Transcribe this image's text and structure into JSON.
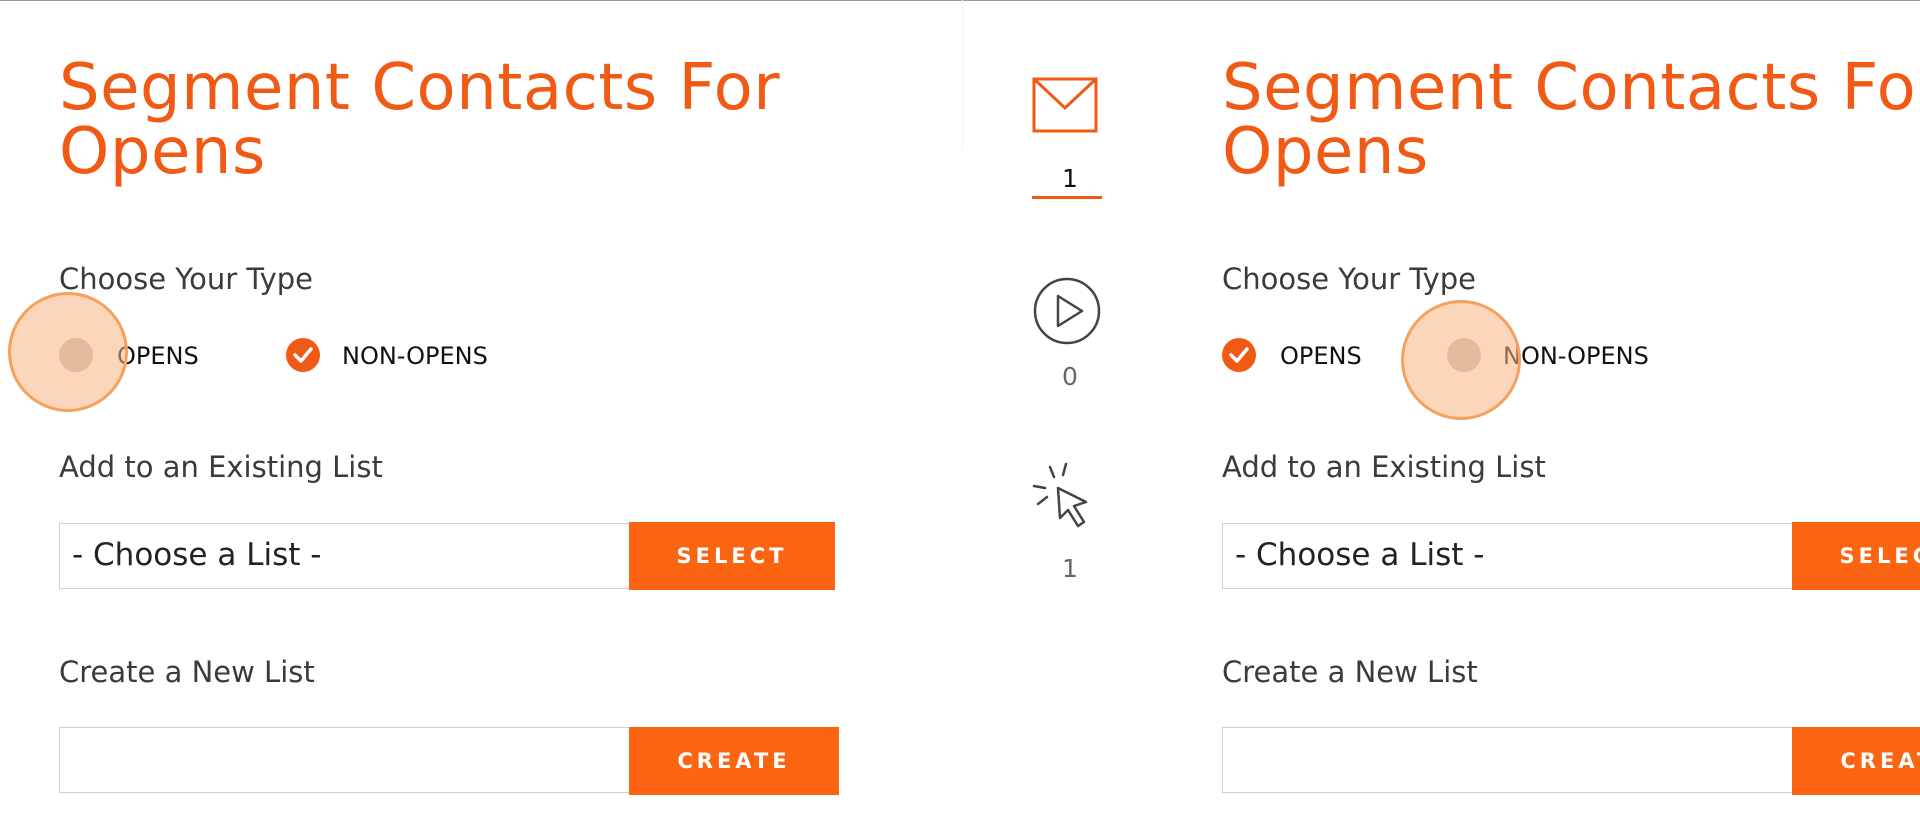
{
  "colors": {
    "accent": "#f05a14",
    "button": "#fb6410",
    "text": "#3b3b3b"
  },
  "panels": [
    {
      "title_line1": "Segment Contacts For",
      "title_line2": "Opens",
      "type_label": "Choose Your Type",
      "options": [
        {
          "label": "OPENS",
          "checked": false
        },
        {
          "label": "NON-OPENS",
          "checked": true
        }
      ],
      "existing_list_label": "Add to an Existing List",
      "list_select_value": "- Choose a List -",
      "select_button": "SELECT",
      "new_list_label": "Create a New List",
      "new_list_value": "",
      "create_button": "CREATE"
    },
    {
      "title_line1": "Segment Contacts For",
      "title_line2": "Opens",
      "type_label": "Choose Your Type",
      "options": [
        {
          "label": "OPENS",
          "checked": true
        },
        {
          "label": "NON-OPENS",
          "checked": false
        }
      ],
      "existing_list_label": "Add to an Existing List",
      "list_select_value": "- Choose a List -",
      "select_button": "SELECT",
      "new_list_label": "Create a New List",
      "new_list_value": "",
      "create_button": "CREATE"
    }
  ],
  "stats": [
    {
      "icon": "envelope-icon",
      "count": "1"
    },
    {
      "icon": "play-icon",
      "count": "0"
    },
    {
      "icon": "cursor-click-icon",
      "count": "1"
    }
  ]
}
